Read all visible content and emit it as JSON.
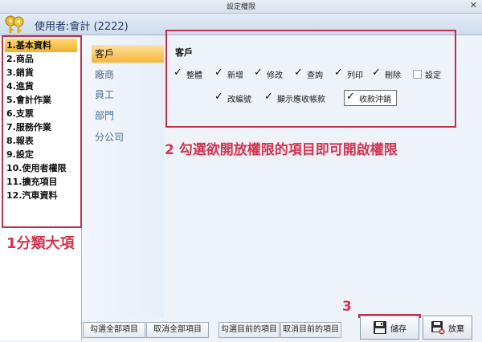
{
  "window": {
    "title": "設定權限",
    "close_glyph": "✕"
  },
  "user": {
    "label": "使用者:會計 (2222)"
  },
  "categories": [
    {
      "label": "1.基本資料",
      "selected": true
    },
    {
      "label": "2.商品"
    },
    {
      "label": "3.銷貨"
    },
    {
      "label": "4.進貨"
    },
    {
      "label": "5.會計作業"
    },
    {
      "label": "6.支票"
    },
    {
      "label": "7.服務作業"
    },
    {
      "label": "8.報表"
    },
    {
      "label": "9.設定"
    },
    {
      "label": "10.使用者權限"
    },
    {
      "label": "11.擴充項目"
    },
    {
      "label": "12.汽車資料"
    }
  ],
  "subtabs": [
    {
      "label": "客戶",
      "selected": true
    },
    {
      "label": "廠商"
    },
    {
      "label": "員工"
    },
    {
      "label": "部門"
    },
    {
      "label": "分公司"
    }
  ],
  "permissions": {
    "group_title": "客戶",
    "row1": [
      {
        "label": "整體",
        "checked": true
      },
      {
        "label": "新增",
        "checked": true
      },
      {
        "label": "修改",
        "checked": true
      },
      {
        "label": "查詢",
        "checked": true
      },
      {
        "label": "列印",
        "checked": true
      },
      {
        "label": "刪除",
        "checked": true
      },
      {
        "label": "設定",
        "checked": false
      }
    ],
    "row2": [
      {
        "label": "改編號",
        "checked": true
      },
      {
        "label": "顯示應收帳款",
        "checked": true
      },
      {
        "label": "收款沖銷",
        "checked": true
      }
    ]
  },
  "annotations": {
    "step1": "1分類大項",
    "step2": "2 勾選欲開放權限的項目即可開啟權限",
    "step3": "3"
  },
  "buttons": {
    "select_all": "勾選全部項目",
    "clear_all": "取消全部項目",
    "select_current": "勾選目前的項目",
    "clear_current": "取消目前的項目",
    "save": "儲存",
    "discard": "放棄"
  },
  "colors": {
    "annotation": "#d2354f",
    "selected_item": "#f2b02a"
  },
  "icons": {
    "keys": "keys-icon",
    "save": "floppy-disk-icon",
    "discard": "floppy-discard-icon"
  }
}
